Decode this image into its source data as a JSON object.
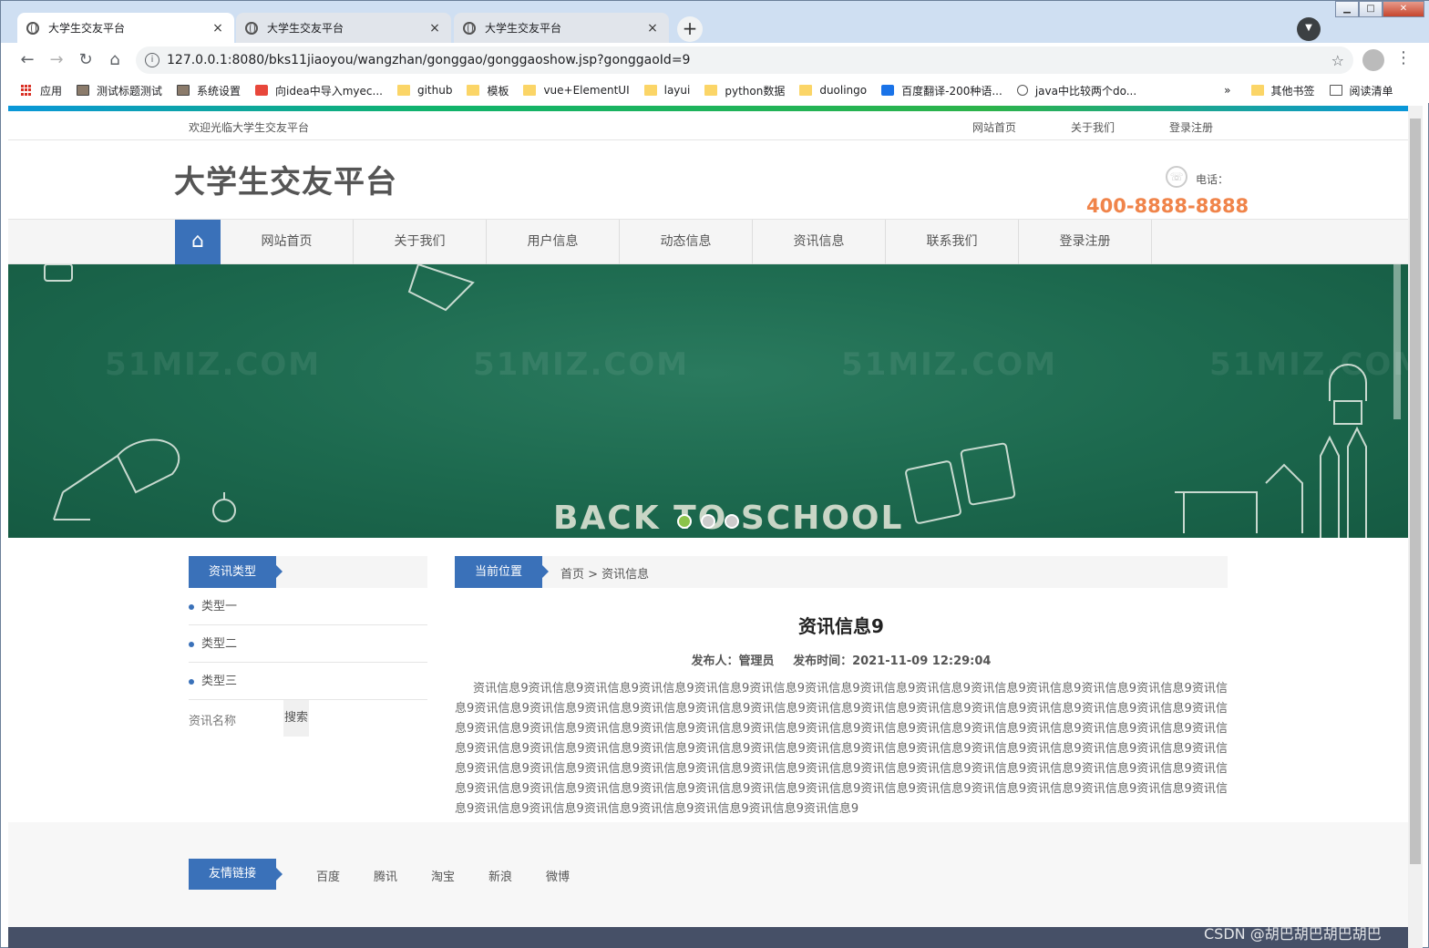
{
  "browser": {
    "tabs": [
      {
        "label": "大学生交友平台",
        "close": "×"
      },
      {
        "label": "大学生交友平台",
        "close": "×"
      },
      {
        "label": "大学生交友平台",
        "close": "×"
      }
    ],
    "new_tab": "+",
    "url": "127.0.0.1:8080/bks11jiaoyou/wangzhan/gonggao/gonggaoshow.jsp?gonggaoId=9",
    "bookmarks": [
      "应用",
      "测试标题测试",
      "系统设置",
      "向idea中导入myec...",
      "github",
      "模板",
      "vue+ElementUI",
      "layui",
      "python数据",
      "duolingo",
      "百度翻译-200种语...",
      "java中比较两个do...",
      "»",
      "其他书签",
      "阅读清单"
    ]
  },
  "site": {
    "welcome": "欢迎光临大学生交友平台",
    "top_links": [
      "网站首页",
      "关于我们",
      "登录注册"
    ],
    "name": "大学生交友平台",
    "phone_label": "电话：",
    "phone": "400-8888-8888",
    "nav": [
      "网站首页",
      "关于我们",
      "用户信息",
      "动态信息",
      "资讯信息",
      "联系我们",
      "登录注册"
    ],
    "banner": {
      "watermark": "51MIZ.COM",
      "slogan": "BACK TO SCHOOL",
      "active_slide": 1
    }
  },
  "sidebar": {
    "title": "资讯类型",
    "items": [
      "类型一",
      "类型二",
      "类型三"
    ],
    "search_label": "资讯名称",
    "search_button": "搜索"
  },
  "main": {
    "crumb_label": "当前位置",
    "crumb": "首页 > 资讯信息",
    "title": "资讯信息9",
    "author": "发布人：管理员",
    "time": "发布时间：2021-11-09 12:29:04",
    "body": "资讯信息9资讯信息9资讯信息9资讯信息9资讯信息9资讯信息9资讯信息9资讯信息9资讯信息9资讯信息9资讯信息9资讯信息9资讯信息9资讯信息9资讯信息9资讯信息9资讯信息9资讯信息9资讯信息9资讯信息9资讯信息9资讯信息9资讯信息9资讯信息9资讯信息9资讯信息9资讯信息9资讯信息9资讯信息9资讯信息9资讯信息9资讯信息9资讯信息9资讯信息9资讯信息9资讯信息9资讯信息9资讯信息9资讯信息9资讯信息9资讯信息9资讯信息9资讯信息9资讯信息9资讯信息9资讯信息9资讯信息9资讯信息9资讯信息9资讯信息9资讯信息9资讯信息9资讯信息9资讯信息9资讯信息9资讯信息9资讯信息9资讯信息9资讯信息9资讯信息9资讯信息9资讯信息9资讯信息9资讯信息9资讯信息9资讯信息9资讯信息9资讯信息9资讯信息9资讯信息9资讯信息9资讯信息9资讯信息9资讯信息9资讯信息9资讯信息9资讯信息9资讯信息9资讯信息9资讯信息9资讯信息9资讯信息9资讯信息9资讯信息9资讯信息9资讯信息9资讯信息9资讯信息9资讯信息9资讯信息9资讯信息9"
  },
  "friend_links": {
    "title": "友情链接",
    "items": [
      "百度",
      "腾讯",
      "淘宝",
      "新浪",
      "微博"
    ]
  },
  "watermark": "CSDN @胡巴胡巴胡巴胡巴"
}
